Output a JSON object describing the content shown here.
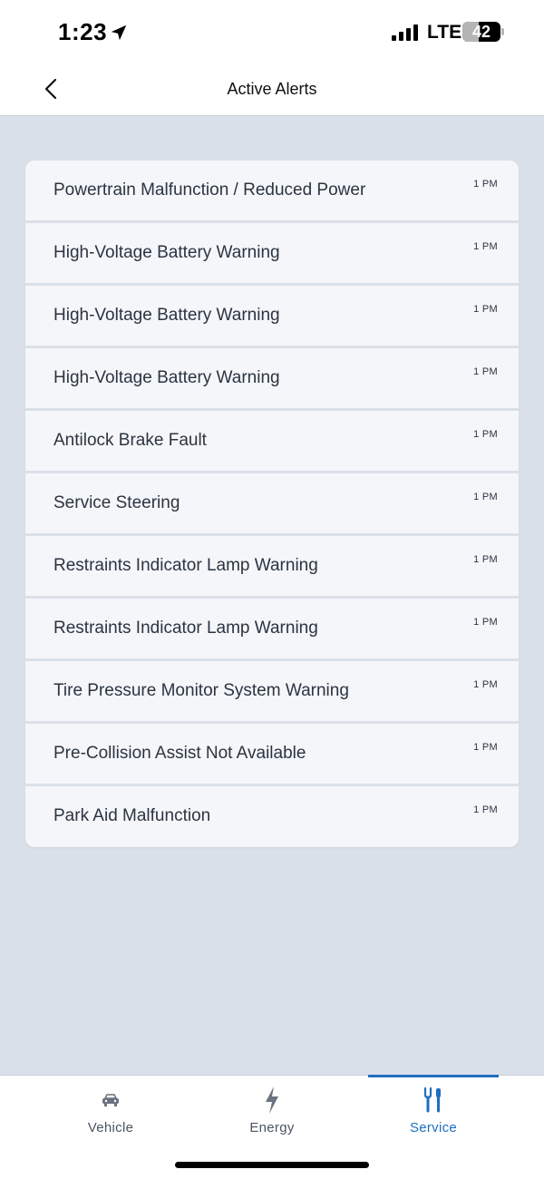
{
  "status_bar": {
    "time": "1:23",
    "network": "LTE",
    "battery": "42",
    "battery_level": 0.42,
    "icons": [
      "location-arrow-icon",
      "signal-icon",
      "battery-icon"
    ]
  },
  "header": {
    "title": "Active Alerts",
    "back_icon": "chevron-left-icon"
  },
  "alerts": [
    {
      "title": "Powertrain Malfunction / Reduced Power",
      "time": "1 PM"
    },
    {
      "title": "High-Voltage Battery Warning",
      "time": "1 PM"
    },
    {
      "title": "High-Voltage Battery Warning",
      "time": "1 PM"
    },
    {
      "title": "High-Voltage Battery Warning",
      "time": "1 PM"
    },
    {
      "title": "Antilock Brake Fault",
      "time": "1 PM"
    },
    {
      "title": "Service Steering",
      "time": "1 PM"
    },
    {
      "title": "Restraints Indicator Lamp Warning",
      "time": "1 PM"
    },
    {
      "title": "Restraints Indicator Lamp Warning",
      "time": "1 PM"
    },
    {
      "title": "Tire Pressure Monitor System Warning",
      "time": "1 PM"
    },
    {
      "title": "Pre-Collision Assist Not Available",
      "time": "1 PM"
    },
    {
      "title": "Park Aid Malfunction",
      "time": "1 PM"
    }
  ],
  "bottom_nav": {
    "items": [
      {
        "label": "Vehicle",
        "icon": "car-icon",
        "active": false
      },
      {
        "label": "Energy",
        "icon": "lightning-bolt-icon",
        "active": false
      },
      {
        "label": "Service",
        "icon": "wrench-screwdriver-icon",
        "active": true
      }
    ]
  },
  "colors": {
    "background": "#dae0ea",
    "card": "#f4f6fa",
    "accent": "#1f6fbf",
    "text": "#2b3440"
  }
}
